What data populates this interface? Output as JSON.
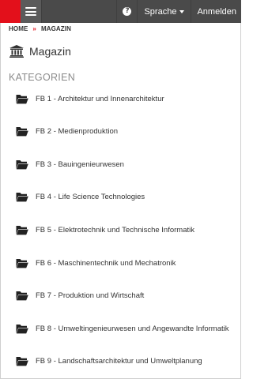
{
  "header": {
    "menu_icon": "hamburger-menu-icon",
    "help_icon": "question-circle-icon",
    "help_glyph": "?",
    "language_label": "Sprache",
    "login_label": "Anmelden",
    "brand_color": "#e3101b",
    "bar_color": "#4a4a4a"
  },
  "breadcrumb": {
    "items": [
      "HOME",
      "MAGAZIN"
    ],
    "separator": "»"
  },
  "page": {
    "title": "Magazin",
    "title_icon": "institution-icon"
  },
  "categories": {
    "heading": "KATEGORIEN",
    "item_icon": "folder-open-icon",
    "items": [
      "FB 1 - Architektur und Innenarchitektur",
      "FB 2 - Medienproduktion",
      "FB 3 - Bauingenieurwesen",
      "FB 4 - Life Science Technologies",
      "FB 5 - Elektrotechnik und Technische Informatik",
      "FB 6 - Maschinentechnik und Mechatronik",
      "FB 7 - Produktion und Wirtschaft",
      "FB 8 - Umweltingenieurwesen und Angewandte Informatik",
      "FB 9 - Landschaftsarchitektur und Umweltplanung"
    ]
  }
}
